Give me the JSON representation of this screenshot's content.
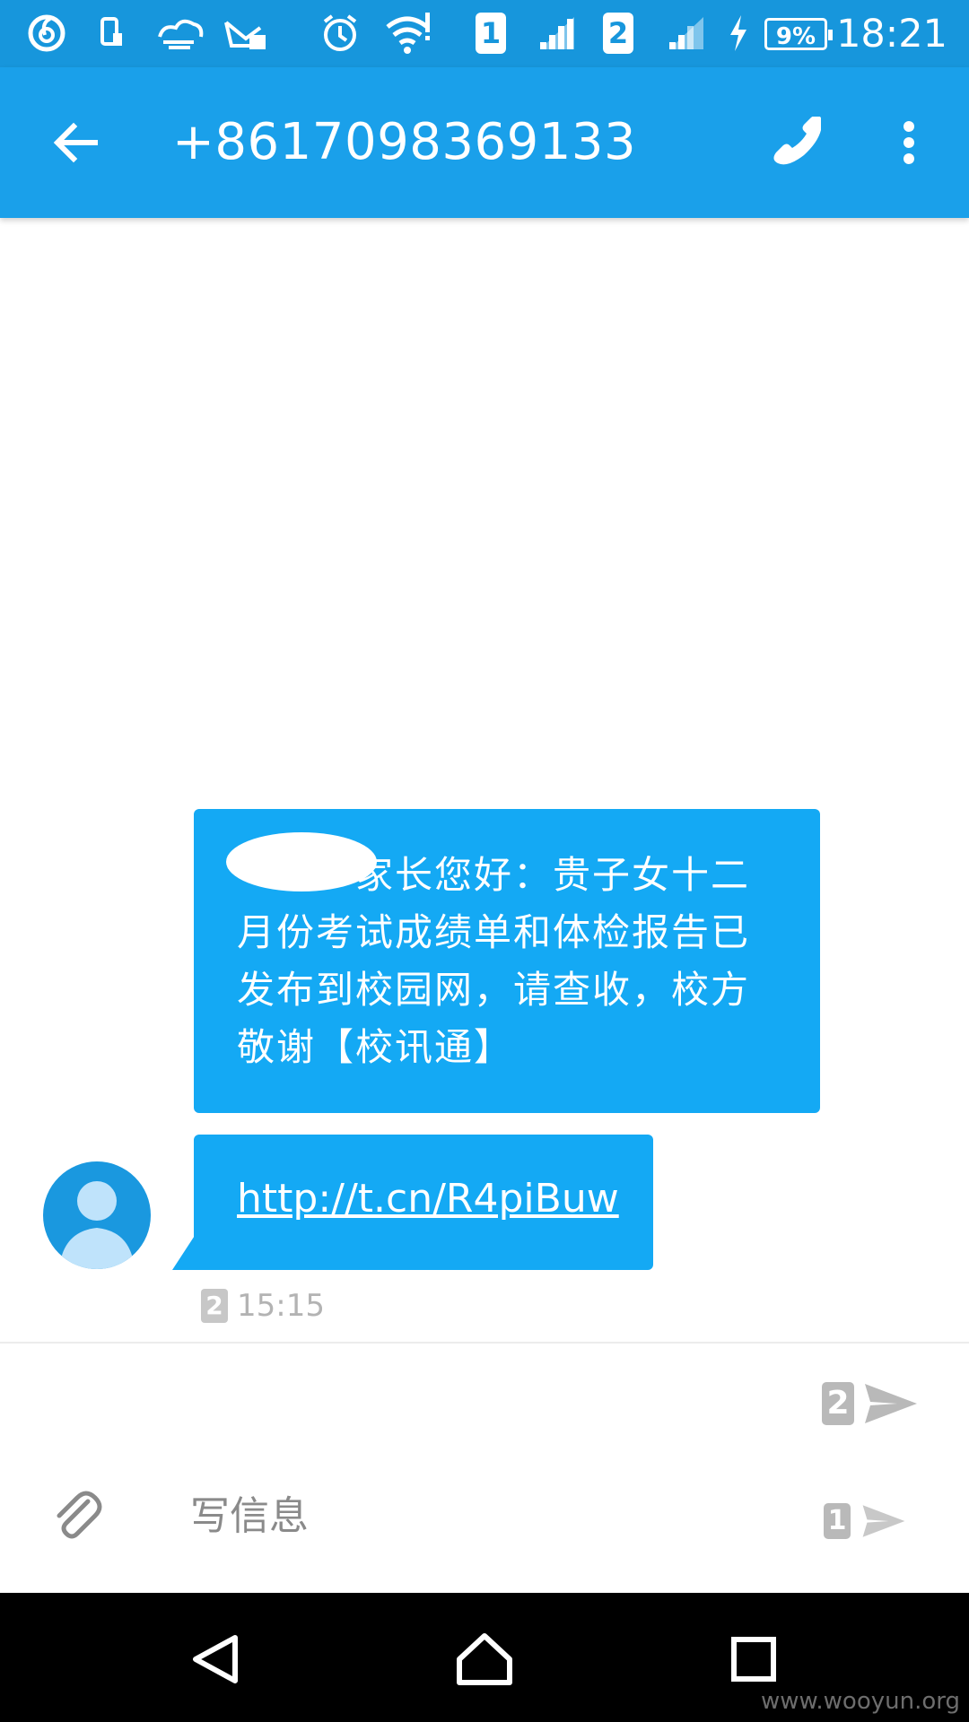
{
  "status_bar": {
    "sim1_label": "1",
    "sim2_label": "2",
    "battery": "9%",
    "time": "18:21"
  },
  "app_bar": {
    "title": "+8617098369133"
  },
  "messages": [
    {
      "text": "家长您好：贵子女十二月份考试成绩单和体检报告已发布到校园网，请查收，校方敬谢【校讯通】"
    },
    {
      "text": "http://t.cn/R4piBuw"
    }
  ],
  "message_meta": {
    "sim": "2",
    "time": "15:15"
  },
  "compose": {
    "placeholder": "写信息",
    "send_sim2": "2",
    "send_sim1": "1"
  },
  "watermark": "www.wooyun.org",
  "colors": {
    "statusbar": "#1796dc",
    "appbar": "#1aa0ea",
    "bubble": "#14a9f4"
  }
}
